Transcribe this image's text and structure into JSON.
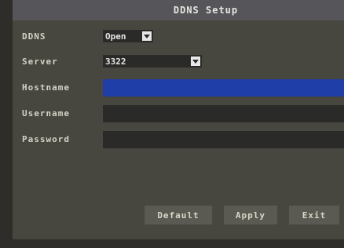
{
  "dialog": {
    "title": "DDNS Setup"
  },
  "fields": {
    "ddns": {
      "label": "DDNS",
      "value": "Open"
    },
    "server": {
      "label": "Server",
      "value": "3322"
    },
    "hostname": {
      "label": "Hostname",
      "value": ""
    },
    "username": {
      "label": "Username",
      "value": ""
    },
    "password": {
      "label": "Password",
      "value": ""
    }
  },
  "buttons": {
    "default_label": "Default",
    "apply_label": "Apply",
    "exit_label": "Exit"
  },
  "colors": {
    "active_field": "#1f3ea8",
    "field_bg": "#2a2a28",
    "panel_bg": "#48473f"
  },
  "icons": {
    "dropdown": "chevron-down-icon"
  }
}
